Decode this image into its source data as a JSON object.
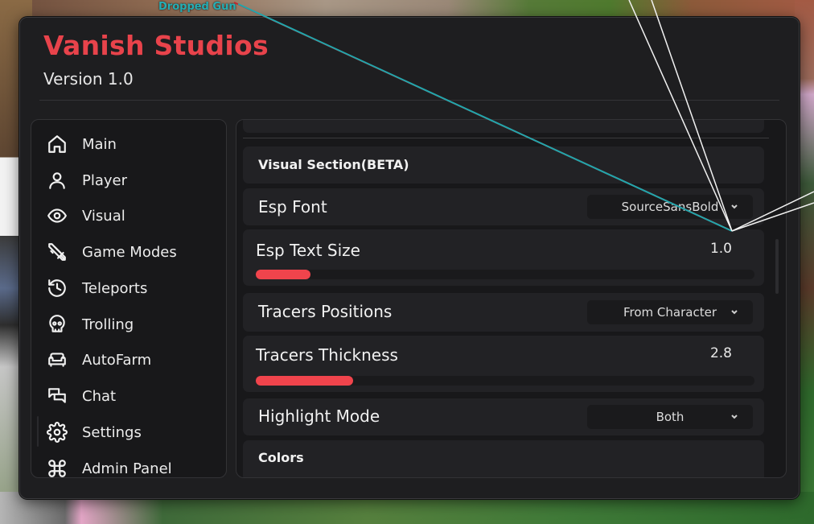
{
  "world": {
    "dropped_item_label": "Dropped Gun"
  },
  "window": {
    "title": "Vanish Studios",
    "version": "Version 1.0",
    "accent_color": "#e8434b"
  },
  "sidebar": {
    "items": [
      {
        "label": "Main",
        "icon": "home-icon"
      },
      {
        "label": "Player",
        "icon": "user-icon"
      },
      {
        "label": "Visual",
        "icon": "eye-icon"
      },
      {
        "label": "Game Modes",
        "icon": "crossed-swords-icon"
      },
      {
        "label": "Teleports",
        "icon": "history-icon"
      },
      {
        "label": "Trolling",
        "icon": "skull-icon"
      },
      {
        "label": "AutoFarm",
        "icon": "sofa-icon"
      },
      {
        "label": "Chat",
        "icon": "chat-bubbles-icon"
      },
      {
        "label": "Settings",
        "icon": "gear-icon"
      },
      {
        "label": "Admin Panel",
        "icon": "command-icon"
      }
    ]
  },
  "content": {
    "section_title": "Visual Section(BETA)",
    "esp_font": {
      "label": "Esp Font",
      "value": "SourceSansBold"
    },
    "esp_text_size": {
      "label": "Esp Text Size",
      "value": "1.0",
      "fill_fraction": 0.11
    },
    "tracers_positions": {
      "label": "Tracers Positions",
      "value": "From Character"
    },
    "tracers_thickness": {
      "label": "Tracers Thickness",
      "value": "2.8",
      "fill_fraction": 0.195
    },
    "highlight_mode": {
      "label": "Highlight Mode",
      "value": "Both"
    },
    "colors": {
      "label": "Colors"
    }
  }
}
